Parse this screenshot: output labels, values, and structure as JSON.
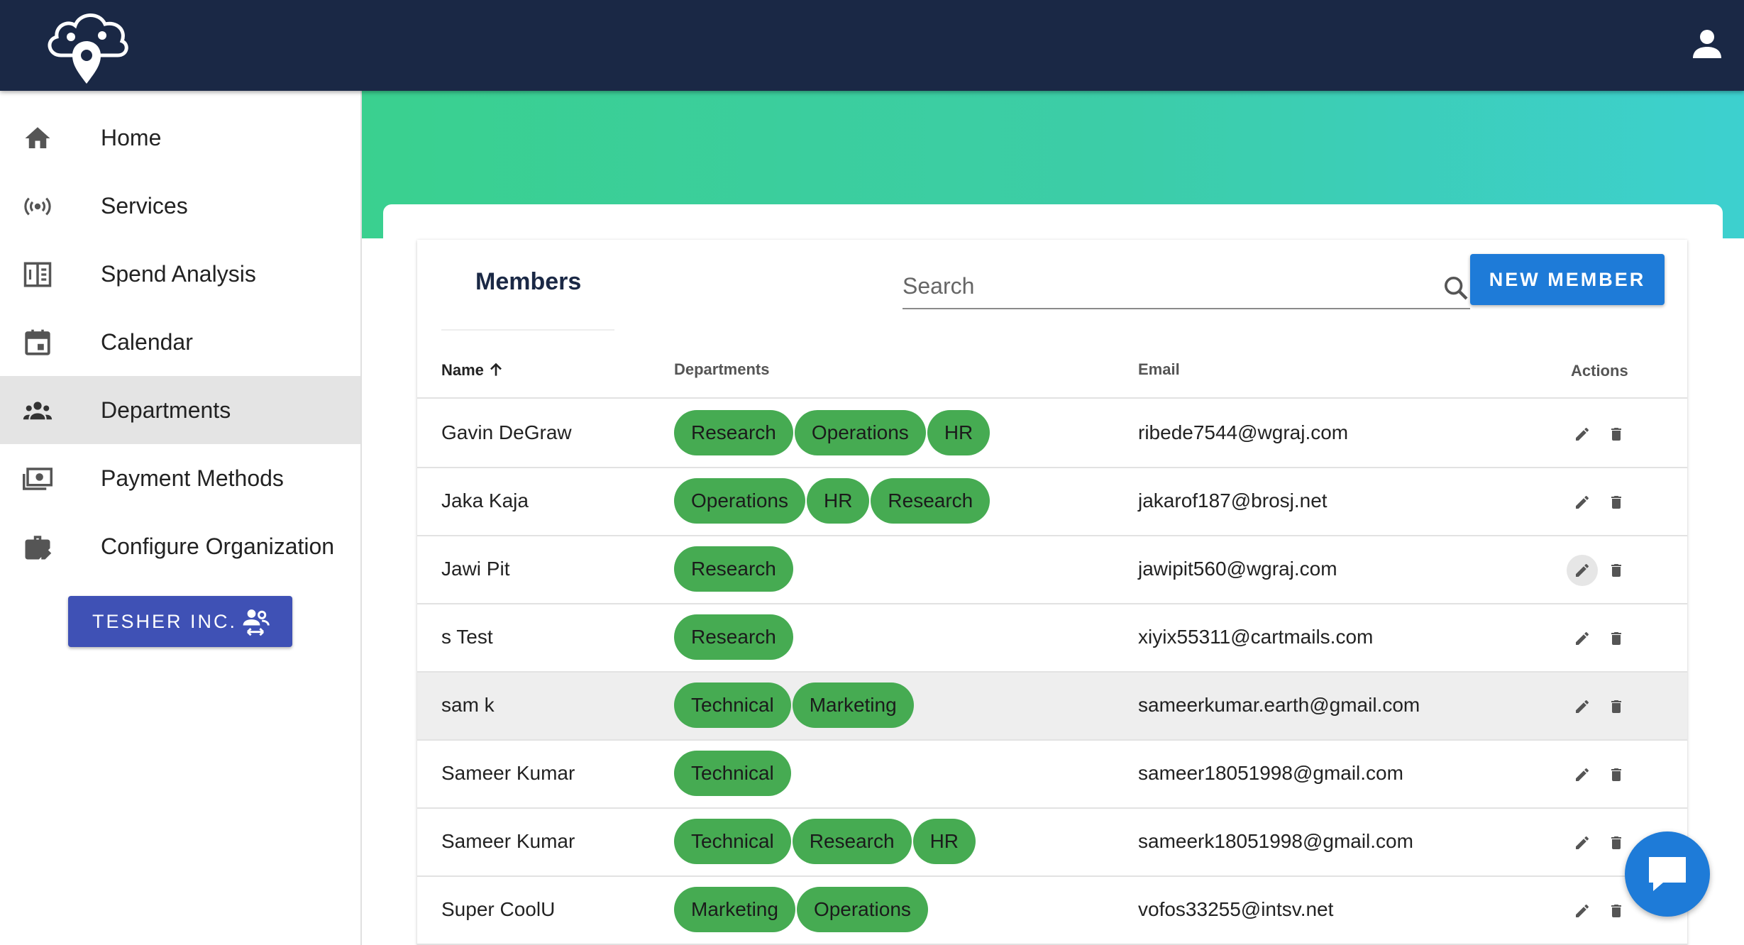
{
  "colors": {
    "topbar": "#1a2845",
    "accent": "#1e7bd8",
    "chip": "#46ab52",
    "org_button": "#3f51b5"
  },
  "sidebar": {
    "items": [
      {
        "label": "Home",
        "icon": "home-icon"
      },
      {
        "label": "Services",
        "icon": "broadcast-icon"
      },
      {
        "label": "Spend Analysis",
        "icon": "calculator-icon"
      },
      {
        "label": "Calendar",
        "icon": "calendar-icon"
      },
      {
        "label": "Departments",
        "icon": "people-icon",
        "active": true
      },
      {
        "label": "Payment Methods",
        "icon": "payment-icon"
      },
      {
        "label": "Configure Organization",
        "icon": "briefcase-edit-icon"
      }
    ],
    "org_button": "TESHER INC."
  },
  "members": {
    "title": "Members",
    "search_placeholder": "Search",
    "new_button": "NEW MEMBER",
    "columns": {
      "name": "Name",
      "departments": "Departments",
      "email": "Email",
      "actions": "Actions"
    },
    "rows": [
      {
        "name": "Gavin DeGraw",
        "departments": [
          "Research",
          "Operations",
          "HR"
        ],
        "email": "ribede7544@wgraj.com"
      },
      {
        "name": "Jaka Kaja",
        "departments": [
          "Operations",
          "HR",
          "Research"
        ],
        "email": "jakarof187@brosj.net"
      },
      {
        "name": "Jawi Pit",
        "departments": [
          "Research"
        ],
        "email": "jawipit560@wgraj.com"
      },
      {
        "name": "s Test",
        "departments": [
          "Research"
        ],
        "email": "xiyix55311@cartmails.com"
      },
      {
        "name": "sam k",
        "departments": [
          "Technical",
          "Marketing"
        ],
        "email": "sameerkumar.earth@gmail.com"
      },
      {
        "name": "Sameer Kumar",
        "departments": [
          "Technical"
        ],
        "email": "sameer18051998@gmail.com"
      },
      {
        "name": "Sameer Kumar",
        "departments": [
          "Technical",
          "Research",
          "HR"
        ],
        "email": "sameerk18051998@gmail.com"
      },
      {
        "name": "Super CoolU",
        "departments": [
          "Marketing",
          "Operations"
        ],
        "email": "vofos33255@intsv.net"
      }
    ]
  }
}
